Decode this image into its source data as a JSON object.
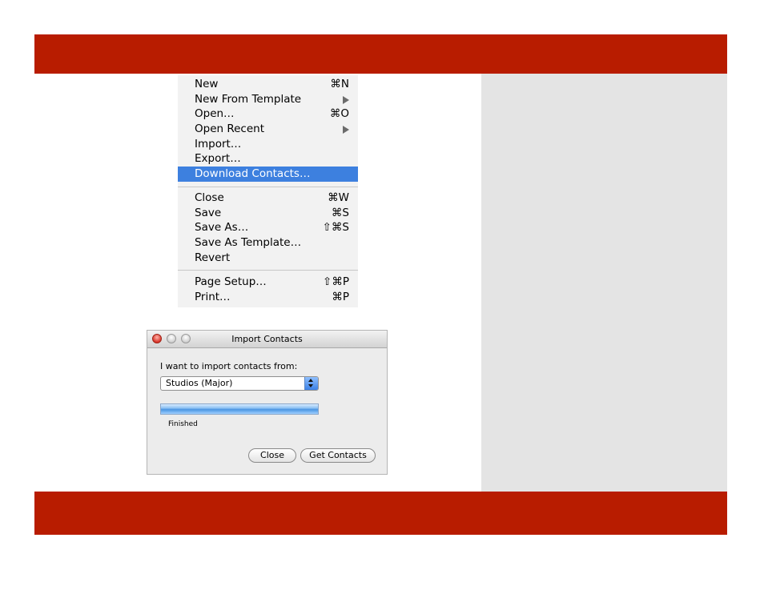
{
  "menu": {
    "items": [
      {
        "label": "New",
        "shortcut": "⌘N"
      },
      {
        "label": "New From Template",
        "submenu": true
      },
      {
        "label": "Open…",
        "shortcut": "⌘O"
      },
      {
        "label": "Open Recent",
        "submenu": true
      },
      {
        "label": "Import…"
      },
      {
        "label": "Export…"
      },
      {
        "label": "Download Contacts…",
        "highlighted": true
      },
      {
        "label": "Close",
        "shortcut": "⌘W"
      },
      {
        "label": "Save",
        "shortcut": "⌘S"
      },
      {
        "label": "Save As…",
        "shortcut": "⇧⌘S"
      },
      {
        "label": "Save As Template…"
      },
      {
        "label": "Revert"
      },
      {
        "label": "Page Setup…",
        "shortcut": "⇧⌘P"
      },
      {
        "label": "Print…",
        "shortcut": "⌘P"
      }
    ]
  },
  "dialog": {
    "title": "Import Contacts",
    "prompt": "I want to import contacts from:",
    "source": "Studios (Major)",
    "progress_percent": 100,
    "status": "Finished",
    "close_label": "Close",
    "get_contacts_label": "Get Contacts"
  },
  "colors": {
    "band": "#b81c00",
    "highlight": "#3d80df",
    "side_panel": "#e4e4e4"
  },
  "icons": {
    "submenu": "submenu-arrow-icon",
    "select_stepper": "select-stepper-icon"
  }
}
